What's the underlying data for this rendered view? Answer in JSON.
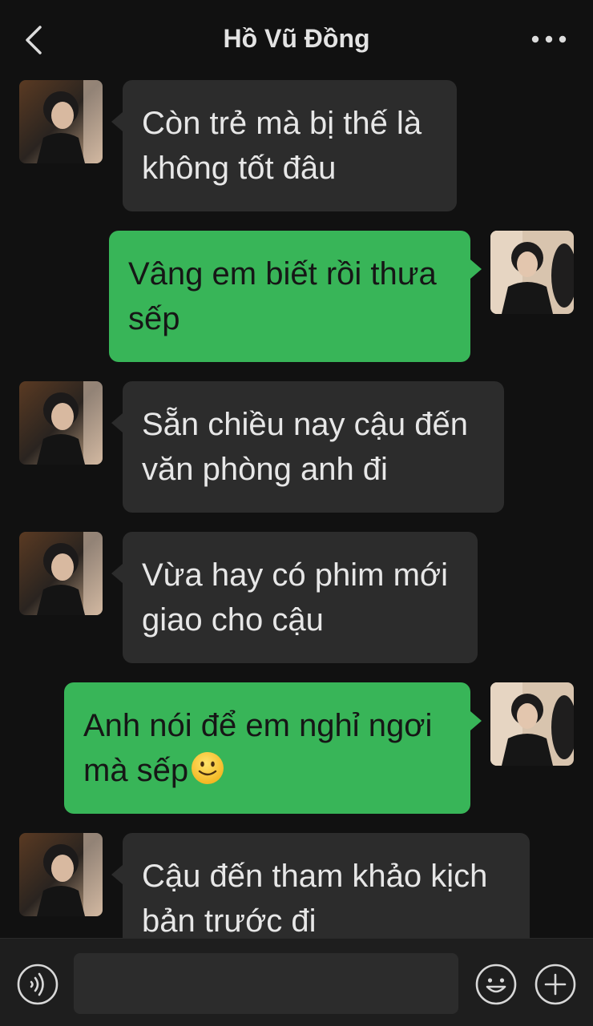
{
  "header": {
    "title": "Hồ Vũ Đồng",
    "back_icon": "chevron-left-icon",
    "more_icon": "more-dots-icon"
  },
  "messages": [
    {
      "side": "in",
      "lines": [
        "Còn trẻ mà bị thế là",
        "không tốt đâu"
      ]
    },
    {
      "side": "out",
      "lines": [
        "Vâng em biết rồi thưa",
        "sếp"
      ]
    },
    {
      "side": "in",
      "lines": [
        "Sẵn chiều nay cậu đến",
        "văn phòng anh đi"
      ]
    },
    {
      "side": "in",
      "lines": [
        "Vừa hay có phim mới",
        "giao cho cậu"
      ]
    },
    {
      "side": "out",
      "lines": [
        "Anh nói để em nghỉ ngơi",
        "mà sếp"
      ],
      "emoji": "slightly-smiling-face-icon"
    },
    {
      "side": "in",
      "lines": [
        "Cậu đến tham khảo kịch",
        "bản trước đi"
      ]
    }
  ],
  "composer": {
    "input_value": "",
    "voice_icon": "voice-icon",
    "emoji_icon": "emoji-icon",
    "plus_icon": "plus-icon"
  },
  "colors": {
    "background": "#111111",
    "incoming_bubble": "#2c2c2c",
    "outgoing_bubble": "#38b558",
    "bottom_bar": "#1e1e1e"
  }
}
